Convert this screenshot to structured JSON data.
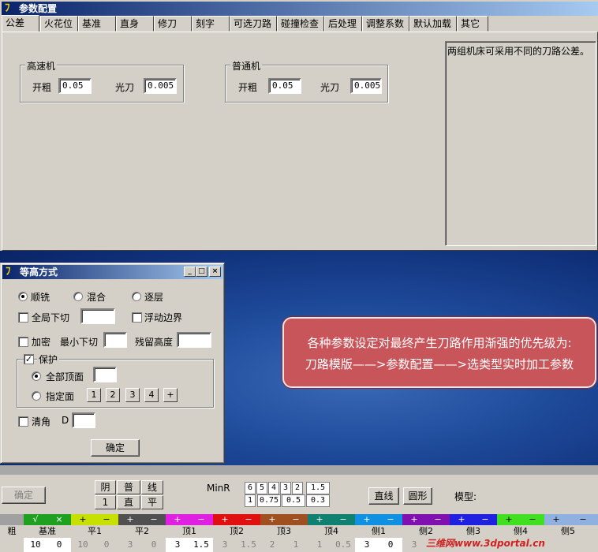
{
  "window": {
    "title": "参数配置"
  },
  "tabs": [
    "公差",
    "火花位",
    "基准",
    "直身",
    "修刀",
    "刻字",
    "可选刀路",
    "碰撞检查",
    "后处理",
    "调整系数",
    "默认加载",
    "其它"
  ],
  "tolerance": {
    "high_speed": {
      "title": "高速机",
      "rough_label": "开粗",
      "rough_value": "0.05",
      "finish_label": "光刀",
      "finish_value": "0.005"
    },
    "normal": {
      "title": "普通机",
      "rough_label": "开粗",
      "rough_value": "0.05",
      "finish_label": "光刀",
      "finish_value": "0.005"
    },
    "note": "两组机床可采用不同的刀路公差。"
  },
  "callout": {
    "line1": "各种参数设定对最终产生刀路作用渐强的优先级为:",
    "line2": "刀路模版——>参数配置——>选类型实时加工参数"
  },
  "dialog": {
    "title": "等高方式",
    "radio_climb": "顺铣",
    "radio_mixed": "混合",
    "radio_layer": "逐层",
    "global_cut": "全局下切",
    "float_boundary": "浮动边界",
    "densify": "加密",
    "min_cut": "最小下切",
    "residual": "残留高度",
    "protect": "保护",
    "all_top": "全部顶面",
    "spec_face": "指定面",
    "face_buttons": [
      "1",
      "2",
      "3",
      "4",
      "+"
    ],
    "clear_corner": "清角",
    "d_label": "D",
    "ok": "确定"
  },
  "bottom": {
    "ok": "确定",
    "top_row": [
      "阴",
      "普",
      "线"
    ],
    "mid_row": [
      "1",
      "直",
      "平"
    ],
    "minr": "MinR",
    "minr_top": [
      "6",
      "5",
      "4",
      "3",
      "2",
      "1.5"
    ],
    "minr_bot": [
      "1",
      "0.75",
      "0.5",
      "0.3"
    ],
    "line_btn": "直线",
    "circle_btn": "圆形",
    "model_label": "模型:",
    "strip_signs": [
      "√",
      "×",
      "+",
      "−",
      "+",
      "−",
      "+",
      "−",
      "+",
      "−",
      "+",
      "−",
      "+",
      "−",
      "+",
      "−",
      "+",
      "−",
      "+",
      "−",
      "+",
      "−",
      "+",
      "−"
    ],
    "labels": [
      "粗",
      "基准",
      "平1",
      "平2",
      "顶1",
      "顶2",
      "顶3",
      "顶4",
      "侧1",
      "侧2",
      "侧3",
      "侧4",
      "侧5"
    ],
    "values": [
      "10",
      "0",
      "10",
      "0",
      "3",
      "0",
      "3",
      "1.5",
      "3",
      "1.5",
      "2",
      "1",
      "1",
      "0.5",
      "3",
      "0",
      "3"
    ],
    "watermark": "三维网www.3dportal.cn"
  }
}
